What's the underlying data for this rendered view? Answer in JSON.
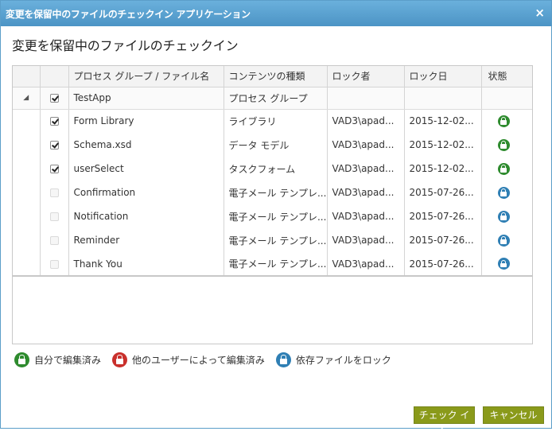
{
  "window": {
    "title": "変更を保留中のファイルのチェックイン アプリケーション",
    "close_label": "×"
  },
  "heading": "変更を保留中のファイルのチェックイン",
  "table": {
    "columns": [
      "",
      "",
      "プロセス グループ / ファイル名",
      "コンテンツの種類",
      "ロック者",
      "ロック日",
      "状態"
    ],
    "group": {
      "expander": "◢",
      "checked": true,
      "name": "TestApp",
      "type": "プロセス グループ"
    },
    "rows": [
      {
        "name": "Form Library",
        "type": "ライブラリ",
        "locked_by": "VAD3\\apad...",
        "lock_date": "2015-12-02...",
        "checked": true,
        "enabled": true,
        "state": "green"
      },
      {
        "name": "Schema.xsd",
        "type": "データ モデル",
        "locked_by": "VAD3\\apad...",
        "lock_date": "2015-12-02...",
        "checked": true,
        "enabled": true,
        "state": "green"
      },
      {
        "name": "userSelect",
        "type": "タスクフォーム",
        "locked_by": "VAD3\\apad...",
        "lock_date": "2015-12-02...",
        "checked": true,
        "enabled": true,
        "state": "green"
      },
      {
        "name": "Confirmation",
        "type": "電子メール テンプレ...",
        "locked_by": "VAD3\\apad...",
        "lock_date": "2015-07-26...",
        "checked": false,
        "enabled": false,
        "state": "blue"
      },
      {
        "name": "Notification",
        "type": "電子メール テンプレ...",
        "locked_by": "VAD3\\apad...",
        "lock_date": "2015-07-26...",
        "checked": false,
        "enabled": false,
        "state": "blue"
      },
      {
        "name": "Reminder",
        "type": "電子メール テンプレ...",
        "locked_by": "VAD3\\apad...",
        "lock_date": "2015-07-26...",
        "checked": false,
        "enabled": false,
        "state": "blue"
      },
      {
        "name": "Thank You",
        "type": "電子メール テンプレ...",
        "locked_by": "VAD3\\apad...",
        "lock_date": "2015-07-26...",
        "checked": false,
        "enabled": false,
        "state": "blue"
      }
    ]
  },
  "legend": [
    {
      "icon": "lock-green-icon",
      "color": "#2e8b2e",
      "label": "自分で編集済み"
    },
    {
      "icon": "lock-red-icon",
      "color": "#c9302c",
      "label": "他のユーザーによって編集済み"
    },
    {
      "icon": "lock-blue-icon",
      "color": "#2f7fb4",
      "label": "依存ファイルをロック"
    }
  ],
  "buttons": {
    "checkin_label": "チェック イン",
    "cancel_label": "キャンセル"
  },
  "colors": {
    "titlebar": "#5aa3d3",
    "button": "#8a9a1a",
    "lock_self": "#2e8b2e",
    "lock_other": "#c9302c",
    "lock_dependent": "#2f7fb4"
  }
}
